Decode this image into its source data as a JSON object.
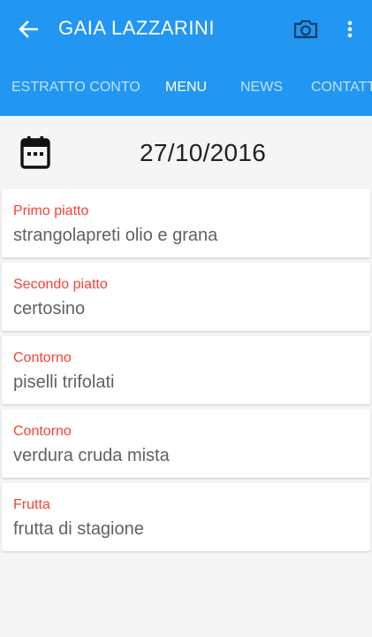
{
  "header": {
    "title": "GAIA LAZZARINI",
    "back_icon": "arrow-back-icon",
    "camera_icon": "camera-icon",
    "more_icon": "more-vert-icon",
    "color": "#2196f3"
  },
  "tabs": [
    {
      "label": "ESTRATTO CONTO",
      "active": false
    },
    {
      "label": "MENU",
      "active": true
    },
    {
      "label": "NEWS",
      "active": false
    },
    {
      "label": "CONTATTI",
      "active": false
    }
  ],
  "date_row": {
    "icon": "calendar-icon",
    "date": "27/10/2016"
  },
  "menu_items": [
    {
      "course": "Primo piatto",
      "dish": "strangolapreti olio e grana"
    },
    {
      "course": "Secondo piatto",
      "dish": "certosino"
    },
    {
      "course": "Contorno",
      "dish": "piselli trifolati"
    },
    {
      "course": "Contorno",
      "dish": "verdura cruda mista"
    },
    {
      "course": "Frutta",
      "dish": "frutta di stagione"
    }
  ],
  "colors": {
    "course_label": "#f44336",
    "dish_text": "#616161",
    "background": "#f5f5f5"
  }
}
